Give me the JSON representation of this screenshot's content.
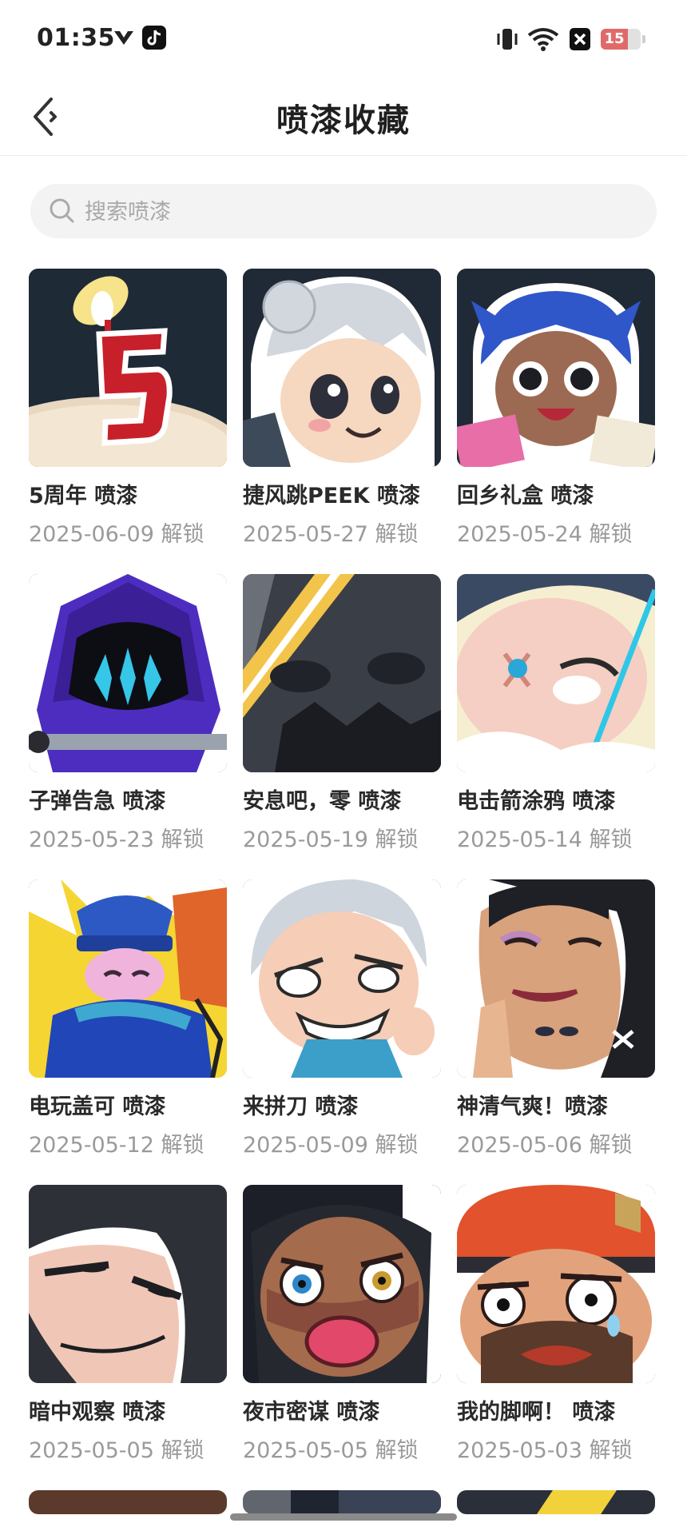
{
  "status_bar": {
    "time": "01:35",
    "battery_level": "15",
    "battery_fraction": 0.15,
    "icons": [
      "vpn-icon",
      "tiktok-icon",
      "vibrate-icon",
      "wifi-icon",
      "sim-off-icon",
      "battery-icon"
    ]
  },
  "nav": {
    "title": "喷漆收藏",
    "back_icon": "back-arrow-icon"
  },
  "search": {
    "placeholder": "搜索喷漆",
    "value": ""
  },
  "sprays": [
    {
      "title": "5周年 喷漆",
      "date": "2025-06-09 解锁"
    },
    {
      "title": "捷风跳PEEK 喷漆",
      "date": "2025-05-27 解锁"
    },
    {
      "title": "回乡礼盒 喷漆",
      "date": "2025-05-24 解锁"
    },
    {
      "title": "子弹告急 喷漆",
      "date": "2025-05-23 解锁"
    },
    {
      "title": "安息吧，零 喷漆",
      "date": "2025-05-19 解锁"
    },
    {
      "title": "电击箭涂鸦 喷漆",
      "date": "2025-05-14 解锁"
    },
    {
      "title": "电玩盖可 喷漆",
      "date": "2025-05-12 解锁"
    },
    {
      "title": "来拼刀 喷漆",
      "date": "2025-05-09 解锁"
    },
    {
      "title": "神清气爽！喷漆",
      "date": "2025-05-06 解锁"
    },
    {
      "title": "暗中观察 喷漆",
      "date": "2025-05-05 解锁"
    },
    {
      "title": "夜市密谋 喷漆",
      "date": "2025-05-05 解锁"
    },
    {
      "title": "我的脚啊！ 喷漆",
      "date": "2025-05-03 解锁"
    }
  ],
  "colors": {
    "accent_red": "#c8202a",
    "text_primary": "#2a2a2a",
    "text_secondary": "#9a9a9a",
    "search_bg": "#f3f3f4"
  }
}
